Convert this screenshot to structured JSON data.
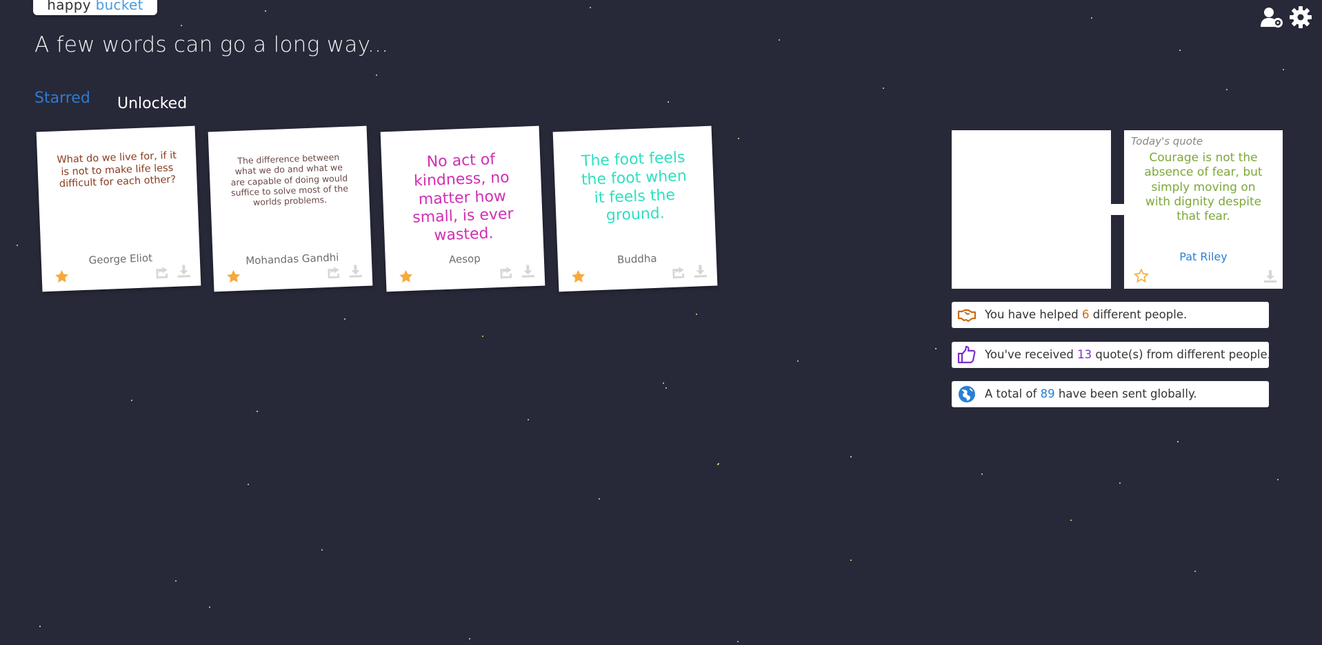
{
  "app": {
    "logo_part1": "happy",
    "logo_part2": "bucket"
  },
  "header": {
    "headline": "A few words can go a long way..."
  },
  "tabs": [
    {
      "label": "Starred",
      "active": true
    },
    {
      "label": "Unlocked",
      "active": false
    }
  ],
  "cards": [
    {
      "quote": "What do we live for, if it is not to make life less difficult for each other?",
      "author": "George Eliot",
      "color": "#8a3b1e",
      "starred": true
    },
    {
      "quote": "The difference between what we do and what we are capable of doing would suffice to solve most of the worlds problems.",
      "author": "Mohandas Gandhi",
      "color": "#6a4b44",
      "starred": true
    },
    {
      "quote": "No act of kindness, no matter how small, is ever wasted.",
      "author": "Aesop",
      "color": "#d12fb3",
      "starred": true
    },
    {
      "quote": "The foot feels the foot when it feels the ground.",
      "author": "Buddha",
      "color": "#2ee0c0",
      "starred": true
    }
  ],
  "today": {
    "label": "Today's quote",
    "quote": "Courage is not the absence of fear, but simply moving on with dignity despite that fear.",
    "author": "Pat Riley",
    "starred": false
  },
  "stats": {
    "helped": {
      "pre": "You have helped",
      "value": "6",
      "post": "different people.",
      "icon": "handshake-icon"
    },
    "received": {
      "pre": "You've received",
      "value": "13",
      "post": "quote(s) from different people.",
      "icon": "thumbs-up-icon"
    },
    "global": {
      "pre": "A total of",
      "value": "89",
      "post": "have been sent globally.",
      "icon": "globe-icon"
    }
  },
  "colors": {
    "background": "#272939",
    "accent": "#2f7bd0",
    "star": "#f7a93a"
  },
  "icons": [
    "user-settings-icon",
    "gear-icon",
    "star-icon",
    "share-icon",
    "download-icon"
  ]
}
